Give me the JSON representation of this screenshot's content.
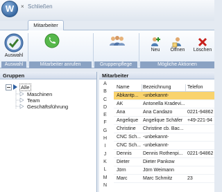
{
  "window": {
    "title": "Schließen",
    "close_glyph": "×"
  },
  "app": {
    "orb_letter": "W"
  },
  "ribbon": {
    "tab": "Mitarbeiter",
    "buttons": {
      "auswahl": "Auswahl",
      "anrufen": "Mitarbeiter anrufen",
      "gruppenpflege": "Gruppenpflege",
      "neu": "Neu",
      "oeffnen": "Öffnen",
      "loeschen": "Löschen"
    },
    "group_label": "Mögliche Aktionen"
  },
  "groups_pane": {
    "title": "Gruppen",
    "root": "Alle",
    "children": [
      "Maschinen",
      "Team",
      "Geschäftsführung"
    ]
  },
  "employees_pane": {
    "title": "Mitarbeiter",
    "alphabet": [
      "A",
      "B",
      "C",
      "D",
      "E",
      "F",
      "G",
      "H",
      "I",
      "J",
      "K",
      "L",
      "M",
      "N"
    ],
    "columns": [
      "Name",
      "Bezeichnung",
      "Telefon"
    ],
    "rows": [
      {
        "name": "Abkantp...",
        "bezeichnung": "-unbekannt-",
        "telefon": "",
        "selected": true
      },
      {
        "name": "AK",
        "bezeichnung": "Antonella Kradevi...",
        "telefon": ""
      },
      {
        "name": "Ana",
        "bezeichnung": "Ana Candazo",
        "telefon": "0221-94862"
      },
      {
        "name": "Angelique",
        "bezeichnung": "Angelique Schäfer",
        "telefon": "+49-221-94"
      },
      {
        "name": "Christine",
        "bezeichnung": "Christine cb. Bac...",
        "telefon": ""
      },
      {
        "name": "CNC Sch...",
        "bezeichnung": "-unbekannt-",
        "telefon": ""
      },
      {
        "name": "CNC Sch...",
        "bezeichnung": "-unbekannt-",
        "telefon": ""
      },
      {
        "name": "Dennis",
        "bezeichnung": "Dennis Rothenpi...",
        "telefon": "0221-94862"
      },
      {
        "name": "Dieter",
        "bezeichnung": "Dieter Pankow",
        "telefon": ""
      },
      {
        "name": "Jörn",
        "bezeichnung": "Jörn Weimann",
        "telefon": ""
      },
      {
        "name": "Marc",
        "bezeichnung": "Marc Schmitz",
        "telefon": "23"
      }
    ]
  },
  "colors": {
    "selection": "#f9d36d",
    "group_label_bg": "#8aa2c3",
    "ribbon_border": "#a9bcd5"
  }
}
